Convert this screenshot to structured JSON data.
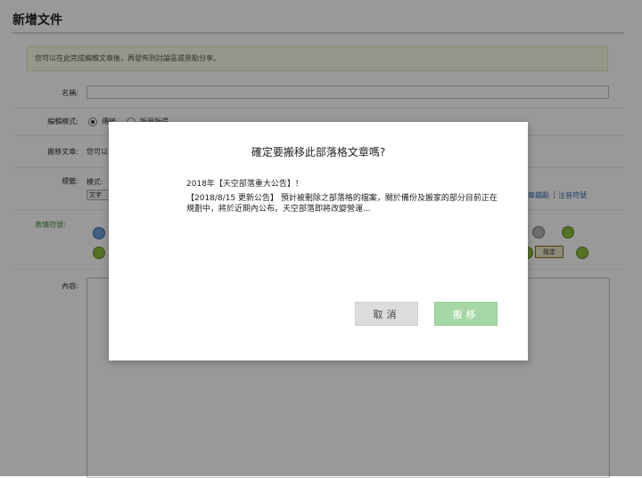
{
  "page": {
    "title": "新增文件",
    "notice": "您可以在此完成編輯文章後，再發佈到討論區或景點分享。",
    "name_label": "名稱:",
    "edit_mode_label": "編輯模式:",
    "edit_mode_options": [
      "傳統",
      "所見所得"
    ],
    "move_article_label": "搬移文章:",
    "move_article_text": "您可以",
    "tags_label": "標籤:",
    "tags_mode_label": "模式:",
    "tags_select": "文字",
    "tag_links": [
      "章錨點",
      "注音符號"
    ],
    "emoticons_label": "表情符號:",
    "emoticons_button": "設定",
    "content_label": "內容:"
  },
  "dialog": {
    "title": "確定要搬移此部落格文章嗎?",
    "post_title": "2018年【天空部落重大公告】！",
    "post_body": "【2018/8/15 更新公告】 預計被刪除之部落格的檔案，關於備份及搬家的部分目前正在規劃中，將於近期內公布。天空部落即將改變營運...",
    "cancel_label": "取消",
    "confirm_label": "搬移"
  },
  "colors": {
    "confirm_button": "#a6d7a6",
    "cancel_button": "#dcdcdc",
    "overlay": "rgba(0,0,0,0.4)"
  }
}
